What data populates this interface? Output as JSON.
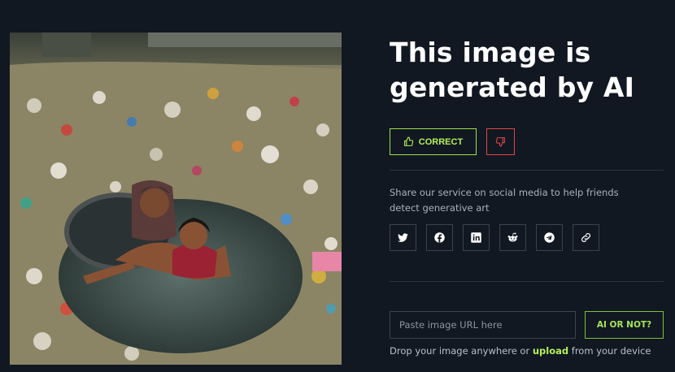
{
  "result": {
    "headline_line1": "This image is",
    "headline_line2": "generated by AI"
  },
  "feedback": {
    "correct_label": "CORRECT",
    "correct_icon": "thumbs-up-icon",
    "wrong_icon": "thumbs-down-icon"
  },
  "share": {
    "text": "Share our service on social media to help friends detect generative art",
    "networks": [
      "twitter-icon",
      "facebook-icon",
      "linkedin-icon",
      "reddit-icon",
      "telegram-icon",
      "link-icon"
    ]
  },
  "checker": {
    "url_placeholder": "Paste image URL here",
    "url_value": "",
    "button_label": "AI OR NOT?",
    "drop_prefix": "Drop your image anywhere or",
    "upload_label": "upload",
    "drop_suffix": "from your device"
  },
  "colors": {
    "background": "#111821",
    "accent_green": "#b4f05a",
    "accent_red": "#e0454a"
  }
}
